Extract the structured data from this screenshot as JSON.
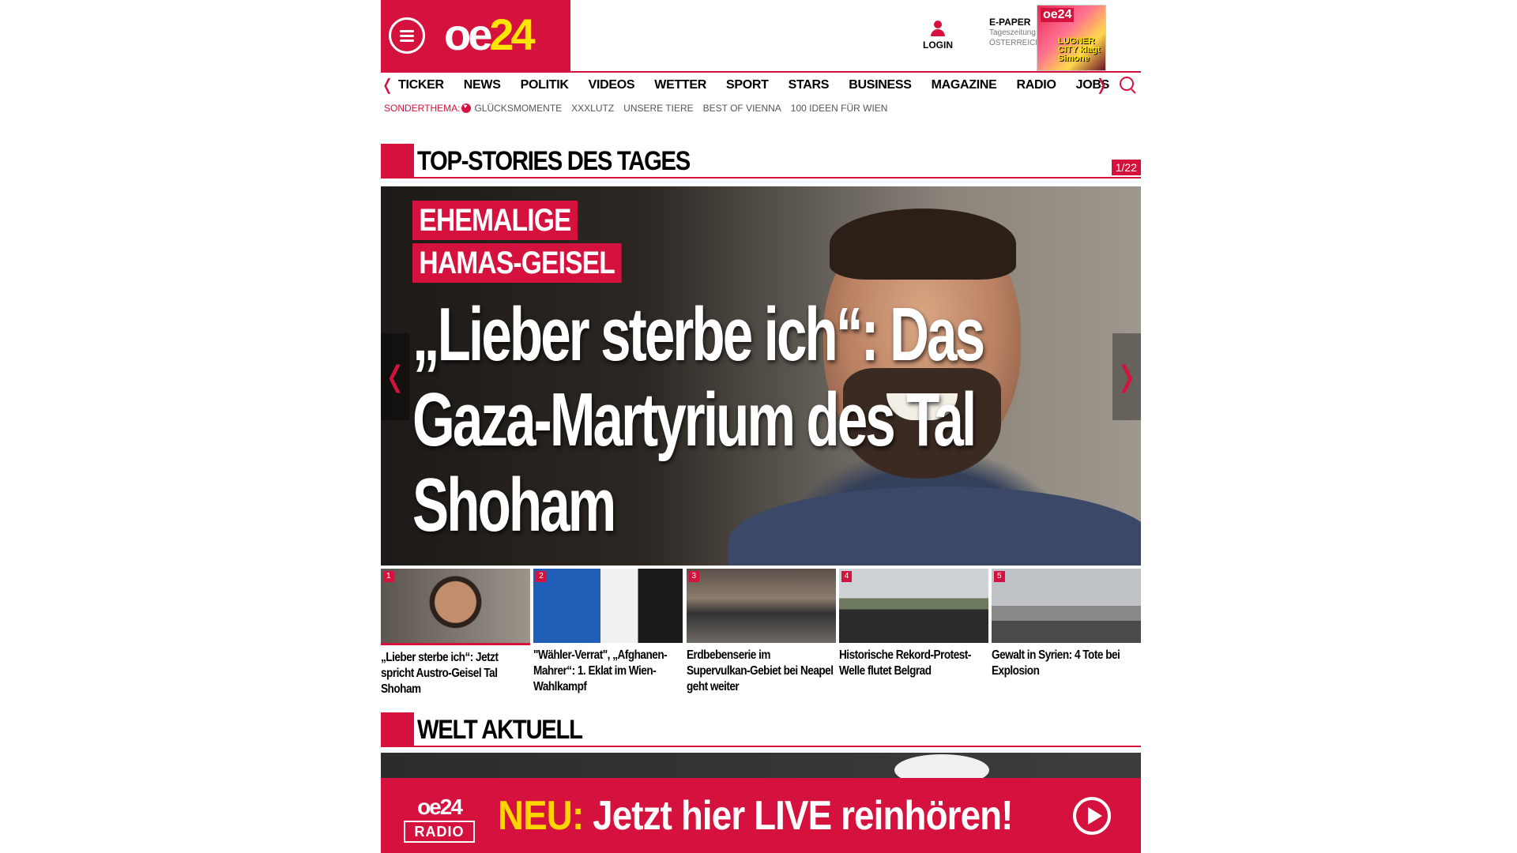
{
  "header": {
    "logo_oe": "oe",
    "logo_24": "24",
    "login_label": "LOGIN",
    "epaper_title": "E-PAPER",
    "epaper_sub1": "Tageszeitung",
    "epaper_sub2": "ÖSTERREICH",
    "epaper_cover_logo": "oe24",
    "epaper_cover_headline": "LUGNER CITY klagt Simone"
  },
  "nav": {
    "items": [
      "TICKER",
      "NEWS",
      "POLITIK",
      "VIDEOS",
      "WETTER",
      "SPORT",
      "STARS",
      "BUSINESS",
      "MAGAZINE",
      "RADIO",
      "JOBS"
    ],
    "prev_glyph": "❬",
    "next_glyph": "❭"
  },
  "subnav": {
    "label": "SONDERTHEMA:",
    "items": [
      "GLÜCKSMOMENTE",
      "XXXLUTZ",
      "UNSERE TIERE",
      "BEST OF VIENNA",
      "100 IDEEN FÜR WIEN"
    ]
  },
  "top_stories": {
    "title": "TOP-STORIES DES TAGES",
    "counter": "1/22",
    "hero": {
      "kicker_line1": "EHEMALIGE",
      "kicker_line2": "HAMAS-GEISEL",
      "headline": "„Lieber sterbe ich“: Das Gaza-Martyrium des Tal Shoham",
      "prev_glyph": "❬",
      "next_glyph": "❭"
    },
    "thumbs": [
      {
        "num": "1",
        "title": "„Lieber sterbe ich“: Jetzt spricht Austro-Geisel Tal Shoham"
      },
      {
        "num": "2",
        "title": "\"Wähler-Verrat\", „Afghanen-Mahrer“: 1. Eklat im Wien-Wahlkampf"
      },
      {
        "num": "3",
        "title": "Erdbebenserie im Supervulkan-Gebiet bei Neapel geht weiter"
      },
      {
        "num": "4",
        "title": "Historische Rekord-Protest-Welle flutet Belgrad"
      },
      {
        "num": "5",
        "title": "Gewalt in Syrien: 4 Tote bei Explosion"
      }
    ]
  },
  "welt": {
    "title": "WELT AKTUELL"
  },
  "radio_banner": {
    "logo_top": "oe24",
    "logo_bottom": "RADIO",
    "neu": "NEU:",
    "text": " Jetzt hier LIVE reinhören!"
  },
  "colors": {
    "brand_red": "#d4123d",
    "brand_yellow": "#ffe600"
  }
}
